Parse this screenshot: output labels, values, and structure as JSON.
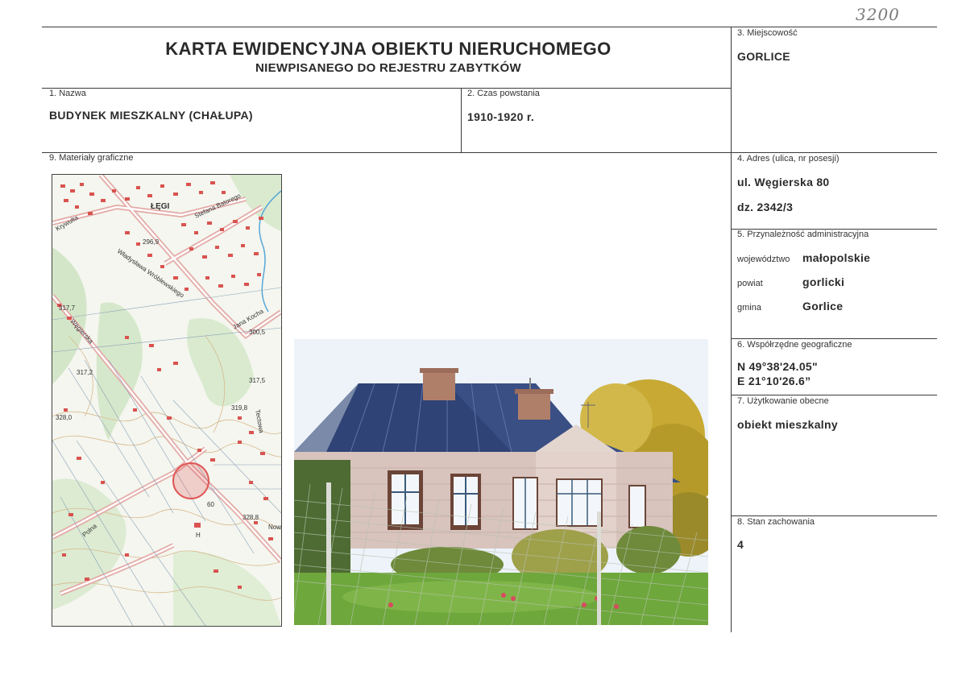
{
  "handwritten_note": "3200",
  "title": {
    "line1": "KARTA EWIDENCYJNA OBIEKTU NIERUCHOMEGO",
    "line2": "NIEWPISANEGO DO REJESTRU ZABYTKÓW"
  },
  "fields": {
    "nazwa": {
      "label": "1. Nazwa",
      "value": "BUDYNEK MIESZKALNY (CHAŁUPA)"
    },
    "czas": {
      "label": "2. Czas powstania",
      "value": "1910-1920 r."
    },
    "miejscowosc": {
      "label": "3. Miejscowość",
      "value": "GORLICE"
    },
    "adres": {
      "label": "4. Adres (ulica, nr posesji)",
      "line1": "ul. Węgierska 80",
      "line2": "dz. 2342/3"
    },
    "przynaleznosc": {
      "label": "5. Przynależność administracyjna",
      "wojewodztwo_label": "województwo",
      "wojewodztwo": "małopolskie",
      "powiat_label": "powiat",
      "powiat": "gorlicki",
      "gmina_label": "gmina",
      "gmina": "Gorlice"
    },
    "wspolrzedne": {
      "label": "6. Współrzędne geograficzne",
      "n": "N 49°38'24.05\"",
      "e": "E 21°10'26.6”"
    },
    "uzytkowanie": {
      "label": "7. Użytkowanie obecne",
      "value": "obiekt mieszkalny"
    },
    "stan": {
      "label": "8. Stan zachowania",
      "value": "4"
    },
    "materialy": {
      "label": "9. Materiały graficzne"
    }
  },
  "map": {
    "labels": {
      "legi": "ŁĘGI",
      "batorego": "Stefana Batorego",
      "krywulta": "Krywulta",
      "wroblewskiego": "Władysława Wróblewskiego",
      "kocha": "Jana Kocha",
      "wegierska": "Węgierska",
      "polna": "Polna",
      "tectowa": "Tectowa",
      "nowa": "Nowa",
      "h1": "296,9",
      "h2": "317,7",
      "h3": "300,5",
      "h4": "317,5",
      "h5": "317,2",
      "h6": "319,8",
      "h7": "328,0",
      "h8": "328,8",
      "h9": "60",
      "h10": "H"
    },
    "colors": {
      "roads": "#e8b7b3",
      "buildings": "#d9534f",
      "water": "#58a6d8",
      "forest": "#cfe3c4",
      "marker": "#e05555"
    }
  }
}
